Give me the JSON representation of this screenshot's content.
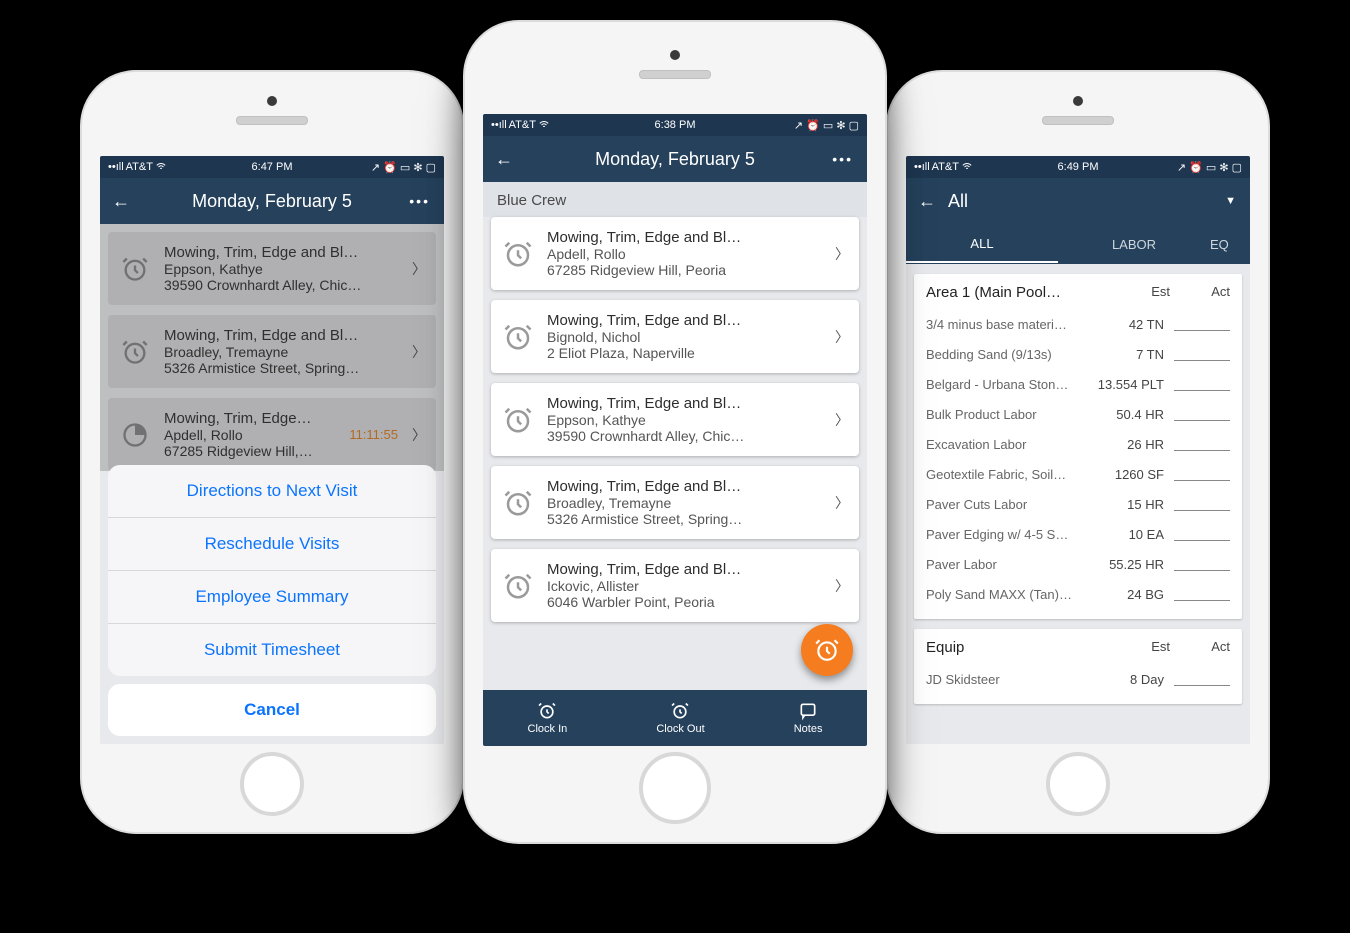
{
  "phone1": {
    "status": {
      "carrier": "AT&T",
      "time": "6:47 PM"
    },
    "header": {
      "title": "Monday, February 5"
    },
    "jobs": [
      {
        "title": "Mowing, Trim, Edge and Bl…",
        "name": "Eppson, Kathye",
        "addr": "39590 Crownhardt Alley, Chic…"
      },
      {
        "title": "Mowing, Trim, Edge and Bl…",
        "name": "Broadley, Tremayne",
        "addr": "5326 Armistice Street, Spring…"
      },
      {
        "title": "Mowing, Trim, Edge…",
        "name": "Apdell, Rollo",
        "addr": "67285 Ridgeview Hill,…",
        "timer": "11:11:55"
      }
    ],
    "sheet": {
      "items": [
        "Directions to Next Visit",
        "Reschedule Visits",
        "Employee Summary",
        "Submit Timesheet"
      ],
      "cancel": "Cancel"
    }
  },
  "phone2": {
    "status": {
      "carrier": "AT&T",
      "time": "6:38 PM"
    },
    "header": {
      "title": "Monday, February 5"
    },
    "section": "Blue Crew",
    "jobs": [
      {
        "title": "Mowing, Trim, Edge and Bl…",
        "name": "Apdell, Rollo",
        "addr": "67285 Ridgeview Hill, Peoria"
      },
      {
        "title": "Mowing, Trim, Edge and Bl…",
        "name": "Bignold, Nichol",
        "addr": "2 Eliot Plaza, Naperville"
      },
      {
        "title": "Mowing, Trim, Edge and Bl…",
        "name": "Eppson, Kathye",
        "addr": "39590 Crownhardt Alley, Chic…"
      },
      {
        "title": "Mowing, Trim, Edge and Bl…",
        "name": "Broadley, Tremayne",
        "addr": "5326 Armistice Street, Spring…"
      },
      {
        "title": "Mowing, Trim, Edge and Bl…",
        "name": "Ickovic, Allister",
        "addr": "6046 Warbler Point, Peoria"
      }
    ],
    "bottombar": {
      "clockin": "Clock In",
      "clockout": "Clock Out",
      "notes": "Notes"
    }
  },
  "phone3": {
    "status": {
      "carrier": "AT&T",
      "time": "6:49 PM"
    },
    "header": {
      "title": "All"
    },
    "tabs": {
      "all": "ALL",
      "labor": "LABOR",
      "equip": "EQ"
    },
    "cols": {
      "est": "Est",
      "act": "Act"
    },
    "group1": {
      "title": "Area 1 (Main Pool…",
      "rows": [
        {
          "name": "3/4 minus base materi…",
          "est": "42 TN"
        },
        {
          "name": "Bedding Sand (9/13s)",
          "est": "7 TN"
        },
        {
          "name": "Belgard - Urbana Ston…",
          "est": "13.554 PLT"
        },
        {
          "name": "Bulk Product Labor",
          "est": "50.4 HR"
        },
        {
          "name": "Excavation Labor",
          "est": "26 HR"
        },
        {
          "name": "Geotextile Fabric, Soil…",
          "est": "1260 SF"
        },
        {
          "name": "Paver Cuts Labor",
          "est": "15 HR"
        },
        {
          "name": "Paver Edging w/ 4-5 S…",
          "est": "10 EA"
        },
        {
          "name": "Paver Labor",
          "est": "55.25 HR"
        },
        {
          "name": "Poly Sand MAXX (Tan)…",
          "est": "24 BG"
        }
      ]
    },
    "group2": {
      "title": "Equip",
      "rows": [
        {
          "name": "JD Skidsteer",
          "est": "8 Day"
        }
      ]
    }
  }
}
